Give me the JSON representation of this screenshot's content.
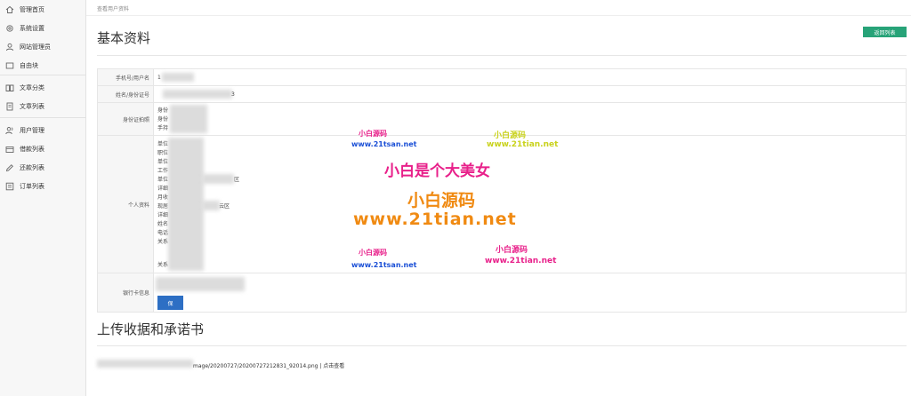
{
  "sidebar": {
    "items": [
      {
        "label": "管理首页",
        "icon": "home-icon"
      },
      {
        "label": "系统设置",
        "icon": "gear-icon"
      },
      {
        "label": "网站管理员",
        "icon": "user-icon"
      },
      {
        "label": "自由块",
        "icon": "block-icon"
      },
      {
        "label": "文章分类",
        "icon": "book-icon"
      },
      {
        "label": "文章列表",
        "icon": "doc-icon"
      },
      {
        "label": "用户管理",
        "icon": "users-icon"
      },
      {
        "label": "借款列表",
        "icon": "wallet-icon"
      },
      {
        "label": "还款列表",
        "icon": "edit-icon"
      },
      {
        "label": "订单列表",
        "icon": "list-icon"
      }
    ]
  },
  "header": {
    "breadcrumb": "查看用户资料",
    "title": "基本资料",
    "back_label": "返回列表"
  },
  "info": {
    "phone_label": "手机号/用户名",
    "phone_value": "1",
    "name_label": "姓名/身份证号",
    "name_value": "3",
    "id_label": "身份证拍照",
    "id_lines": [
      "身份",
      "身份",
      "手持"
    ],
    "personal_label": "个人资料",
    "personal_lines": [
      "单位",
      "职位",
      "单位",
      "工作",
      "单位",
      "详细",
      "月收",
      "现居",
      "详细",
      "姓名",
      "电话",
      "关系",
      "",
      "关系"
    ],
    "personal_suffix_1": "区",
    "personal_suffix_2": "云区",
    "bank_label": "银行卡信息",
    "save_label": "保"
  },
  "watermark": {
    "small_cn": "小白源码",
    "small_url_1": "www.21tsan.net",
    "small_url_2": "www.21tian.net",
    "main_cn": "小白是个大美女",
    "big_cn": "小白源码",
    "big_url": "www.21tian.net"
  },
  "upload": {
    "title": "上传收据和承诺书",
    "file_path": "mage/20200727/20200727212831_92014.png | 点击查看"
  },
  "colors": {
    "accent_green": "#27a378",
    "button_blue": "#2d6fc4",
    "watermark_pink": "#e8208a",
    "watermark_orange": "#f08a12"
  }
}
